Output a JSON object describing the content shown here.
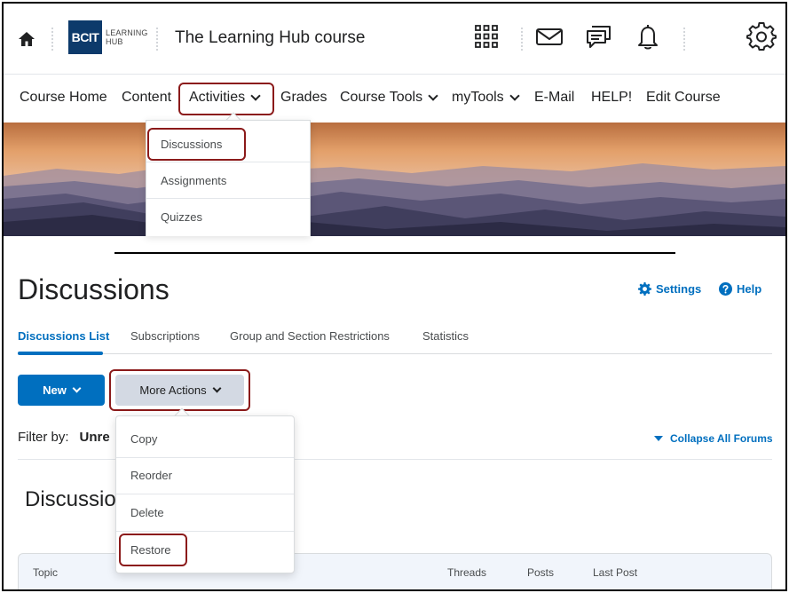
{
  "topbar": {
    "logo_text": "BCIT",
    "logo_sub_1": "LEARNING",
    "logo_sub_2": "HUB",
    "course_title": "The Learning Hub course",
    "icons": [
      "home-icon",
      "waffle-grid-icon",
      "mail-icon",
      "chat-icon",
      "bell-icon",
      "gear-icon"
    ]
  },
  "nav": {
    "items": [
      {
        "label": "Course Home",
        "dropdown": false
      },
      {
        "label": "Content",
        "dropdown": false
      },
      {
        "label": "Activities",
        "dropdown": true,
        "highlighted": true
      },
      {
        "label": "Grades",
        "dropdown": false
      },
      {
        "label": "Course Tools",
        "dropdown": true
      },
      {
        "label": "myTools",
        "dropdown": true
      },
      {
        "label": "E-Mail",
        "dropdown": false
      },
      {
        "label": "HELP!",
        "dropdown": false
      },
      {
        "label": "Edit Course",
        "dropdown": false
      }
    ]
  },
  "activities_menu": {
    "items": [
      {
        "label": "Discussions",
        "highlighted": true
      },
      {
        "label": "Assignments"
      },
      {
        "label": "Quizzes"
      }
    ]
  },
  "discussions": {
    "title": "Discussions",
    "settings_label": "Settings",
    "help_label": "Help",
    "tabs": [
      {
        "label": "Discussions List",
        "active": true
      },
      {
        "label": "Subscriptions"
      },
      {
        "label": "Group and Section Restrictions"
      },
      {
        "label": "Statistics"
      }
    ],
    "new_button": "New",
    "more_actions_button": "More Actions",
    "filter_label": "Filter by:",
    "filter_value": "Unre",
    "collapse_label": "Collapse All Forums",
    "section_title": "Discussio",
    "table_headers": {
      "topic": "Topic",
      "threads": "Threads",
      "posts": "Posts",
      "last_post": "Last Post"
    }
  },
  "more_actions_menu": {
    "items": [
      {
        "label": "Copy"
      },
      {
        "label": "Reorder"
      },
      {
        "label": "Delete"
      },
      {
        "label": "Restore",
        "highlighted": true
      }
    ]
  },
  "colors": {
    "accent": "#006fbf",
    "highlight_border": "#8b1a1a",
    "logo_bg": "#0d3a6b",
    "more_actions_bg": "#d3d9e3"
  }
}
